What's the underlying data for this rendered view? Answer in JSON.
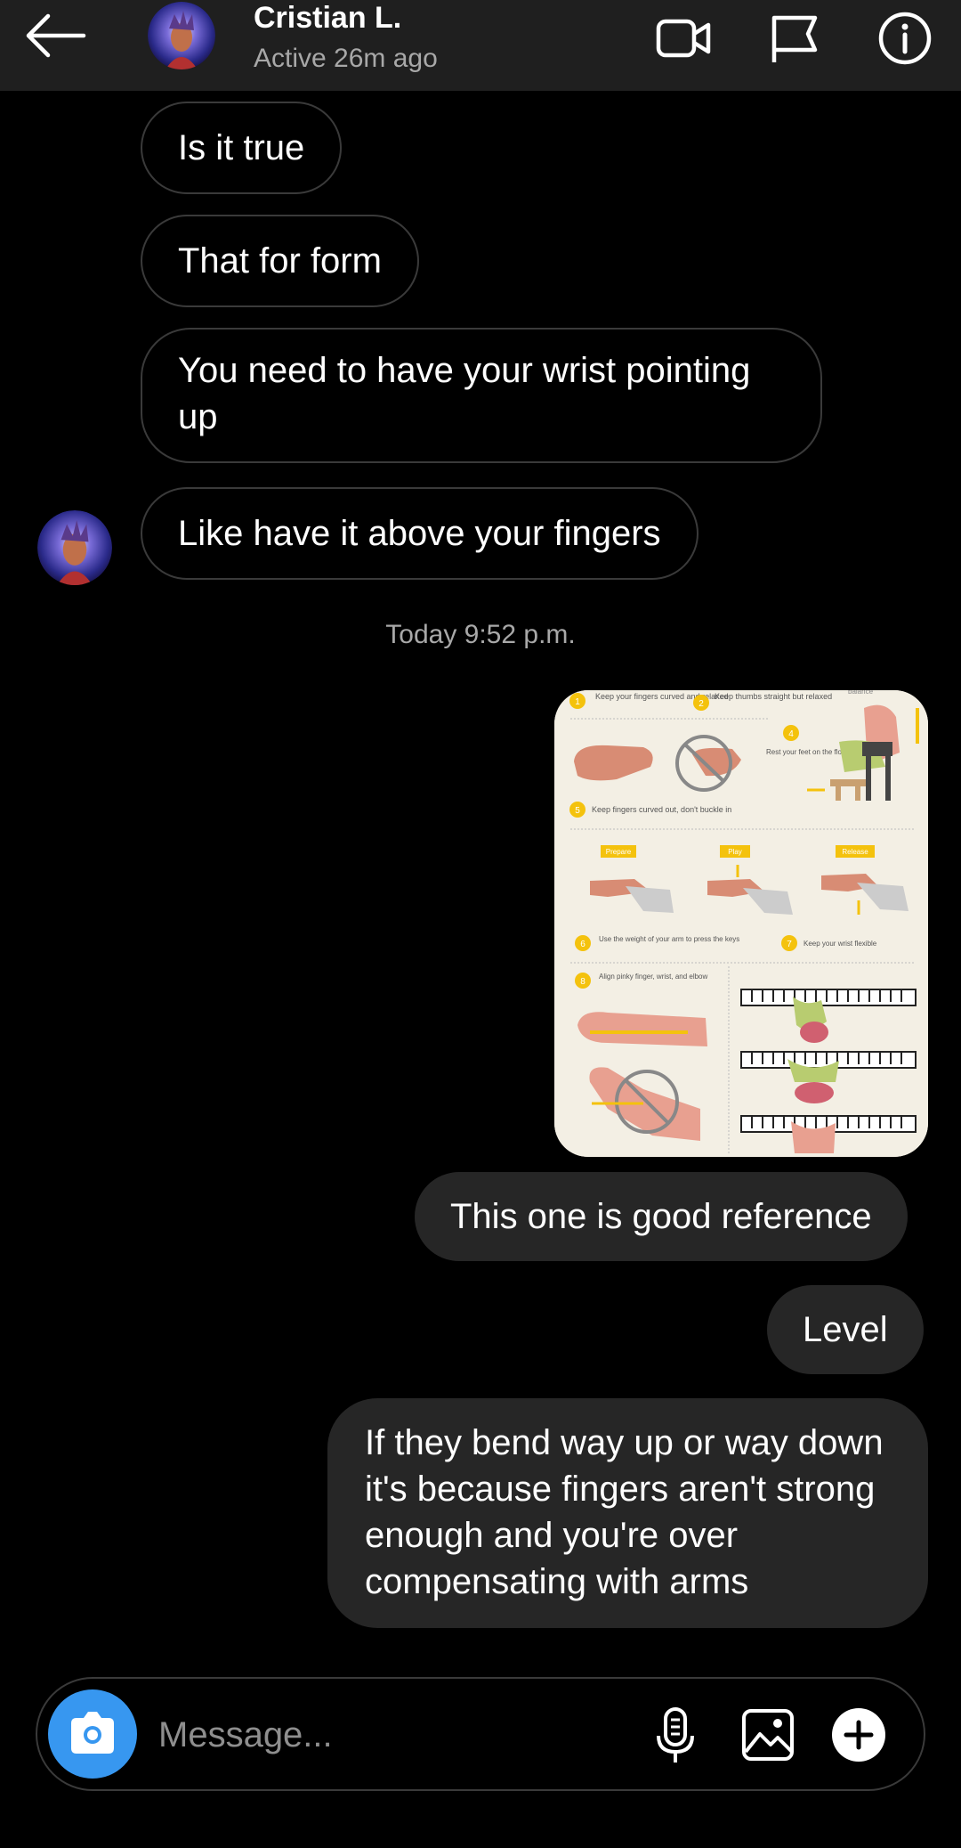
{
  "header": {
    "name": "Cristian L.",
    "status": "Active 26m ago"
  },
  "messages_in": [
    "Is it true",
    "That for form",
    "You need to have your wrist pointing up",
    "Like have it above your fingers"
  ],
  "timestamp": "Today 9:52 p.m.",
  "shared_image": {
    "section_1": "Keep your fingers curved and relaxed",
    "section_2": "Keep thumbs straight but relaxed",
    "feet_note": "Rest your feet on the floor or a footstool",
    "balance_label": "balance",
    "section_5": "Keep fingers curved out, don't buckle in",
    "prepare_label": "Prepare",
    "play_label": "Play",
    "release_label": "Release",
    "weight_note": "Use the weight of your arm to press the keys",
    "wrist_note": "Keep your wrist flexible",
    "align_note": "Align pinky finger, wrist, and elbow",
    "num_1": "1",
    "num_2": "2",
    "num_4": "4",
    "num_5": "5",
    "num_6": "6",
    "num_7": "7",
    "num_8": "8"
  },
  "messages_out": [
    "This one is good reference",
    "Level",
    "If they bend way up or way down it's because fingers aren't strong enough and you're over compensating with arms"
  ],
  "composer": {
    "placeholder": "Message..."
  },
  "colors": {
    "accent": "#3797f0",
    "outgoing_bubble": "#262626",
    "header_bg": "#1f1f1f",
    "diagram_yellow": "#f4c20d"
  }
}
